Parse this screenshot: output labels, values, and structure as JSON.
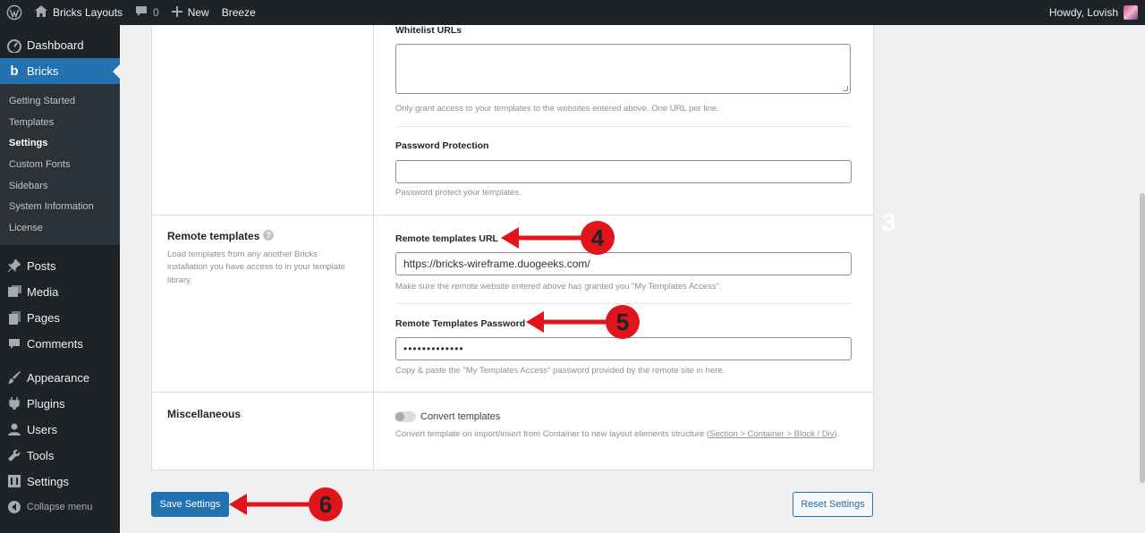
{
  "adminbar": {
    "site_name": "Bricks Layouts",
    "comments_count": "0",
    "new_label": "New",
    "breeze_label": "Breeze",
    "howdy": "Howdy, Lovish"
  },
  "sidebar": {
    "dashboard": "Dashboard",
    "bricks": "Bricks",
    "bricks_submenu": [
      "Getting Started",
      "Templates",
      "Settings",
      "Custom Fonts",
      "Sidebars",
      "System Information",
      "License"
    ],
    "posts": "Posts",
    "media": "Media",
    "pages": "Pages",
    "comments": "Comments",
    "appearance": "Appearance",
    "plugins": "Plugins",
    "users": "Users",
    "tools": "Tools",
    "settings": "Settings",
    "collapse": "Collapse menu"
  },
  "templates_access": {
    "whitelist_label": "Whitelist URLs",
    "whitelist_value": "",
    "whitelist_desc": "Only grant access to your templates to the websites entered above. One URL per line.",
    "password_label": "Password Protection",
    "password_value": "",
    "password_desc": "Password protect your templates."
  },
  "remote_templates": {
    "title": "Remote templates",
    "help_glyph": "?",
    "desc": "Load templates from any another Bricks installation you have access to in your template library.",
    "url_label": "Remote templates URL",
    "url_value": "https://bricks-wireframe.duogeeks.com/",
    "url_desc": "Make sure the remote website entered above has granted you \"My Templates Access\".",
    "password_label": "Remote Templates Password",
    "password_value": "•••••••••••••",
    "password_desc": "Copy & paste the \"My Templates Access\" password provided by the remote site in here."
  },
  "miscellaneous": {
    "title": "Miscellaneous",
    "toggle_label": "Convert templates",
    "toggle_on": false,
    "desc_prefix": "Convert template on import/insert from Container to new layout elements structure (",
    "desc_link": "Section > Container > Block / Div",
    "desc_suffix": ")."
  },
  "buttons": {
    "save": "Save Settings",
    "reset": "Reset Settings"
  },
  "annotations": {
    "step_3": "3",
    "step_4": "4",
    "step_5": "5",
    "step_6": "6"
  },
  "colors": {
    "accent": "#2271b1",
    "annotation_red": "#e0141a",
    "adminbar_bg": "#1d2327"
  }
}
